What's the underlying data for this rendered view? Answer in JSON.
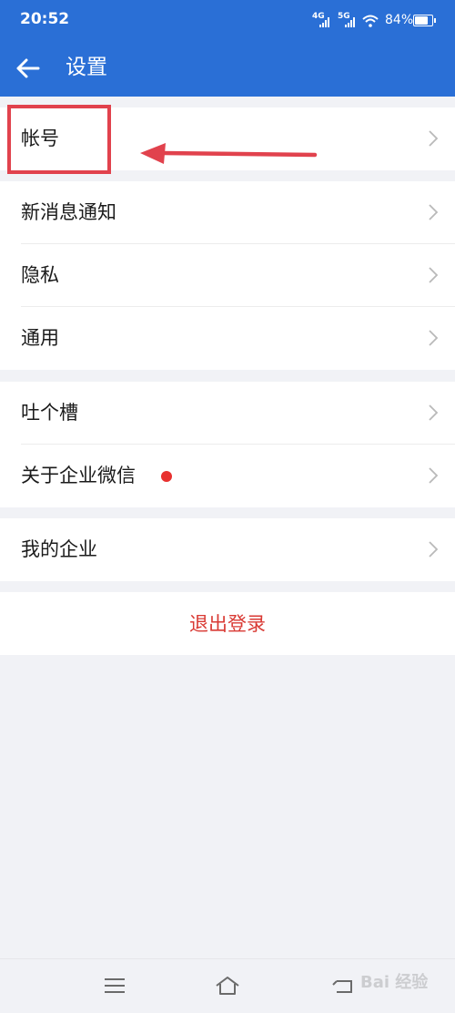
{
  "status_bar": {
    "time": "20:52",
    "network_1": "4G",
    "network_2": "5G",
    "battery": "84%"
  },
  "header": {
    "title": "设置",
    "back_icon": "arrow-left-icon"
  },
  "groups": [
    {
      "items": [
        {
          "label": "帐号"
        }
      ]
    },
    {
      "items": [
        {
          "label": "新消息通知"
        },
        {
          "label": "隐私"
        },
        {
          "label": "通用"
        }
      ]
    },
    {
      "items": [
        {
          "label": "吐个槽"
        },
        {
          "label": "关于企业微信",
          "badge": "red-dot"
        }
      ]
    },
    {
      "items": [
        {
          "label": "我的企业"
        }
      ]
    }
  ],
  "logout_label": "退出登录",
  "colors": {
    "header_bg": "#2a6fd6",
    "logout_text": "#d93a34",
    "annotation": "#e1424d"
  },
  "watermark_text": "Bai 经验",
  "nav_icons": [
    "menu-icon",
    "home-icon",
    "back-icon"
  ]
}
